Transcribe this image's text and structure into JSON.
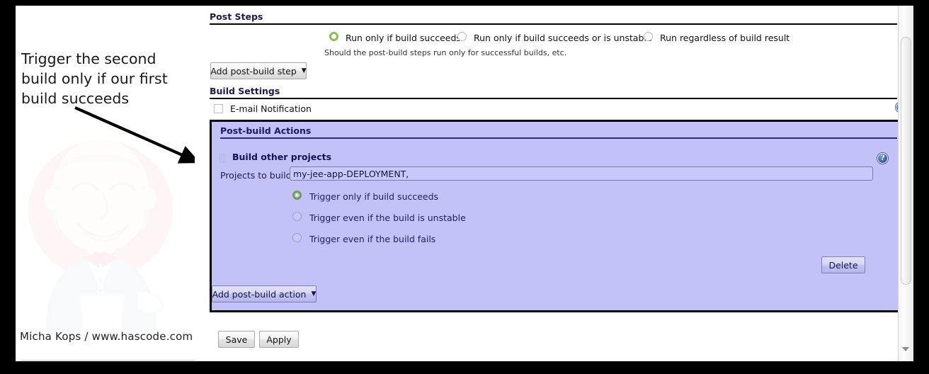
{
  "annotation": {
    "text": "Trigger the second build only if our first build succeeds",
    "caption": "Micha Kops / www.hascode.com"
  },
  "post_steps": {
    "heading": "Post Steps",
    "hint": "Should the post-build steps run only for successful builds, etc.",
    "options": [
      {
        "label": "Run only if build succeeds",
        "checked": true
      },
      {
        "label": "Run only if build succeeds or is unstable",
        "checked": false
      },
      {
        "label": "Run regardless of build result",
        "checked": false
      }
    ],
    "add_step_button": "Add post-build step"
  },
  "build_settings": {
    "heading": "Build Settings",
    "email_notification_label": "E-mail Notification",
    "email_notification_checked": false,
    "help_icon": "help-icon"
  },
  "post_build_actions": {
    "heading": "Post-build Actions",
    "help_icon": "help-icon",
    "grip_icon": "drag-grip-icon",
    "block_title": "Build other projects",
    "projects_label": "Projects to build",
    "projects_value": "my-jee-app-DEPLOYMENT,",
    "projects_placeholder": "",
    "trigger_options": [
      {
        "label": "Trigger only if build succeeds",
        "checked": true
      },
      {
        "label": "Trigger even if the build is unstable",
        "checked": false
      },
      {
        "label": "Trigger even if the build fails",
        "checked": false
      }
    ],
    "delete_button": "Delete",
    "add_action_button": "Add post-build action"
  },
  "footer": {
    "save_button": "Save",
    "apply_button": "Apply"
  },
  "colors": {
    "panel_background": "#c2c2f9",
    "panel_border": "#000000",
    "accent_text": "#1a1a60",
    "radio_checked_ring": "#8cbf54",
    "help_icon_blue": "#3c63ab"
  },
  "scrollbar": {
    "down_arrow_icon": "chevron-down-icon"
  }
}
